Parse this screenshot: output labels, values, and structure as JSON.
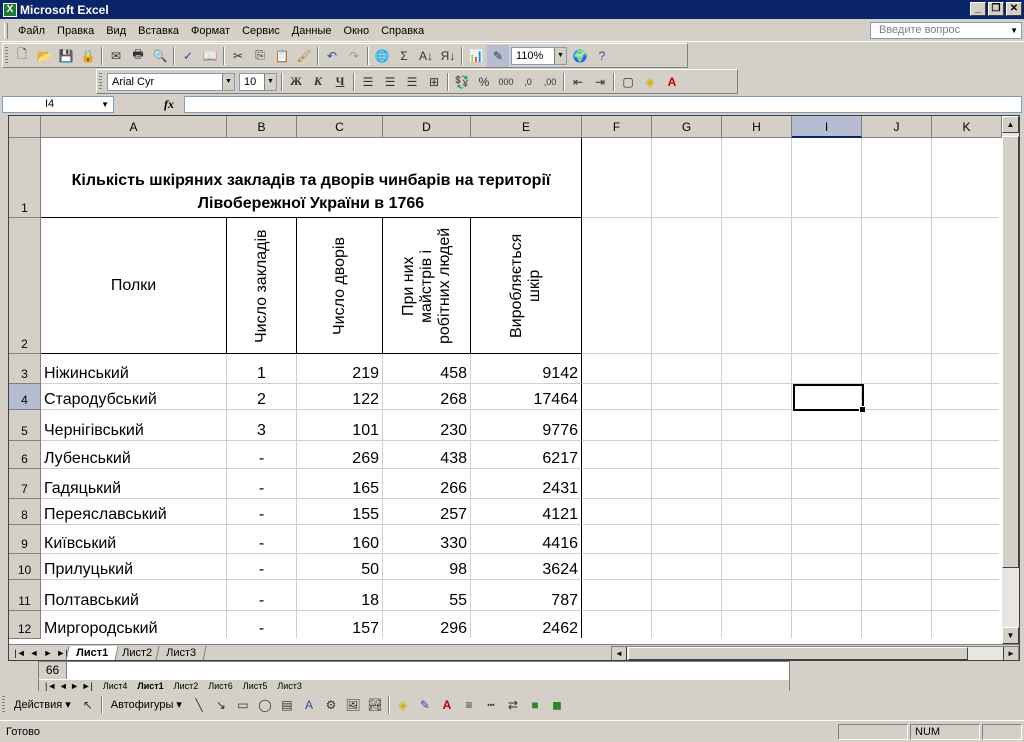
{
  "window": {
    "title": "Microsoft Excel",
    "min": "_",
    "restore": "❐",
    "close": "✕"
  },
  "menu": [
    "Файл",
    "Правка",
    "Вид",
    "Вставка",
    "Формат",
    "Сервис",
    "Данные",
    "Окно",
    "Справка"
  ],
  "ask_placeholder": "Введите вопрос",
  "toolbar": {
    "zoom": "110%"
  },
  "format": {
    "font": "Arial Cyr",
    "size": "10",
    "bold": "Ж",
    "italic": "К",
    "underline": "Ч"
  },
  "namebox": "I4",
  "fx": "fx",
  "columns": [
    "A",
    "B",
    "C",
    "D",
    "E",
    "F",
    "G",
    "H",
    "I",
    "J",
    "K"
  ],
  "selected_column": "I",
  "rows": [
    "1",
    "2",
    "3",
    "4",
    "5",
    "6",
    "7",
    "8",
    "9",
    "10",
    "11",
    "12"
  ],
  "sheet": {
    "title": "Кількість шкіряних закладів та дворів чинбарів на території Лівобережної України в 1766",
    "headers": {
      "a": "Полки",
      "b": "Число закладів",
      "c": "Число дворів",
      "d": "При них майстрів і робітних людей",
      "e": "Виробляється шкір"
    },
    "data": [
      [
        "Ніжинський",
        "1",
        "219",
        "458",
        "9142"
      ],
      [
        "Стародубський",
        "2",
        "122",
        "268",
        "17464"
      ],
      [
        "Чернігівський",
        "3",
        "101",
        "230",
        "9776"
      ],
      [
        "Лубенський",
        "-",
        "269",
        "438",
        "6217"
      ],
      [
        "Гадяцький",
        "-",
        "165",
        "266",
        "2431"
      ],
      [
        "Переяславський",
        "-",
        "155",
        "257",
        "4121"
      ],
      [
        "Київський",
        "-",
        "160",
        "330",
        "4416"
      ],
      [
        "Прилуцький",
        "-",
        "50",
        "98",
        "3624"
      ],
      [
        "Полтавський",
        "-",
        "18",
        "55",
        "787"
      ],
      [
        "Миргородський",
        "-",
        "157",
        "296",
        "2462"
      ]
    ]
  },
  "tabs": [
    "Лист1",
    "Лист2",
    "Лист3"
  ],
  "behind": {
    "row": "66",
    "tabs": [
      "Лист4",
      "Лист1",
      "Лист2",
      "Лист6",
      "Лист5",
      "Лист3"
    ]
  },
  "draw": {
    "actions": "Действия",
    "autoshapes": "Автофигуры"
  },
  "status": {
    "ready": "Готово",
    "num": "NUM"
  }
}
